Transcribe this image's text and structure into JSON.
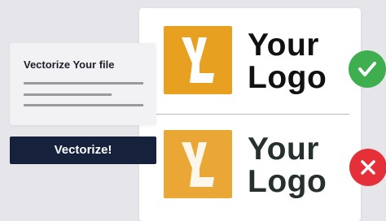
{
  "panel": {
    "title": "Vectorize Your file"
  },
  "vectorize_button": {
    "label": "Vectorize!"
  },
  "logos": {
    "line1": "Your",
    "line2": "Logo",
    "mark_letter_icon": "stylized-YL-monogram",
    "crisp": {
      "mark_color": "#e8a020",
      "text_color": "#111111",
      "status_icon": "check-icon",
      "status_color": "#3fae4f"
    },
    "blurry": {
      "mark_color": "#eaa735",
      "text_color": "#26302e",
      "status_icon": "x-icon",
      "status_color": "#e63039"
    }
  }
}
